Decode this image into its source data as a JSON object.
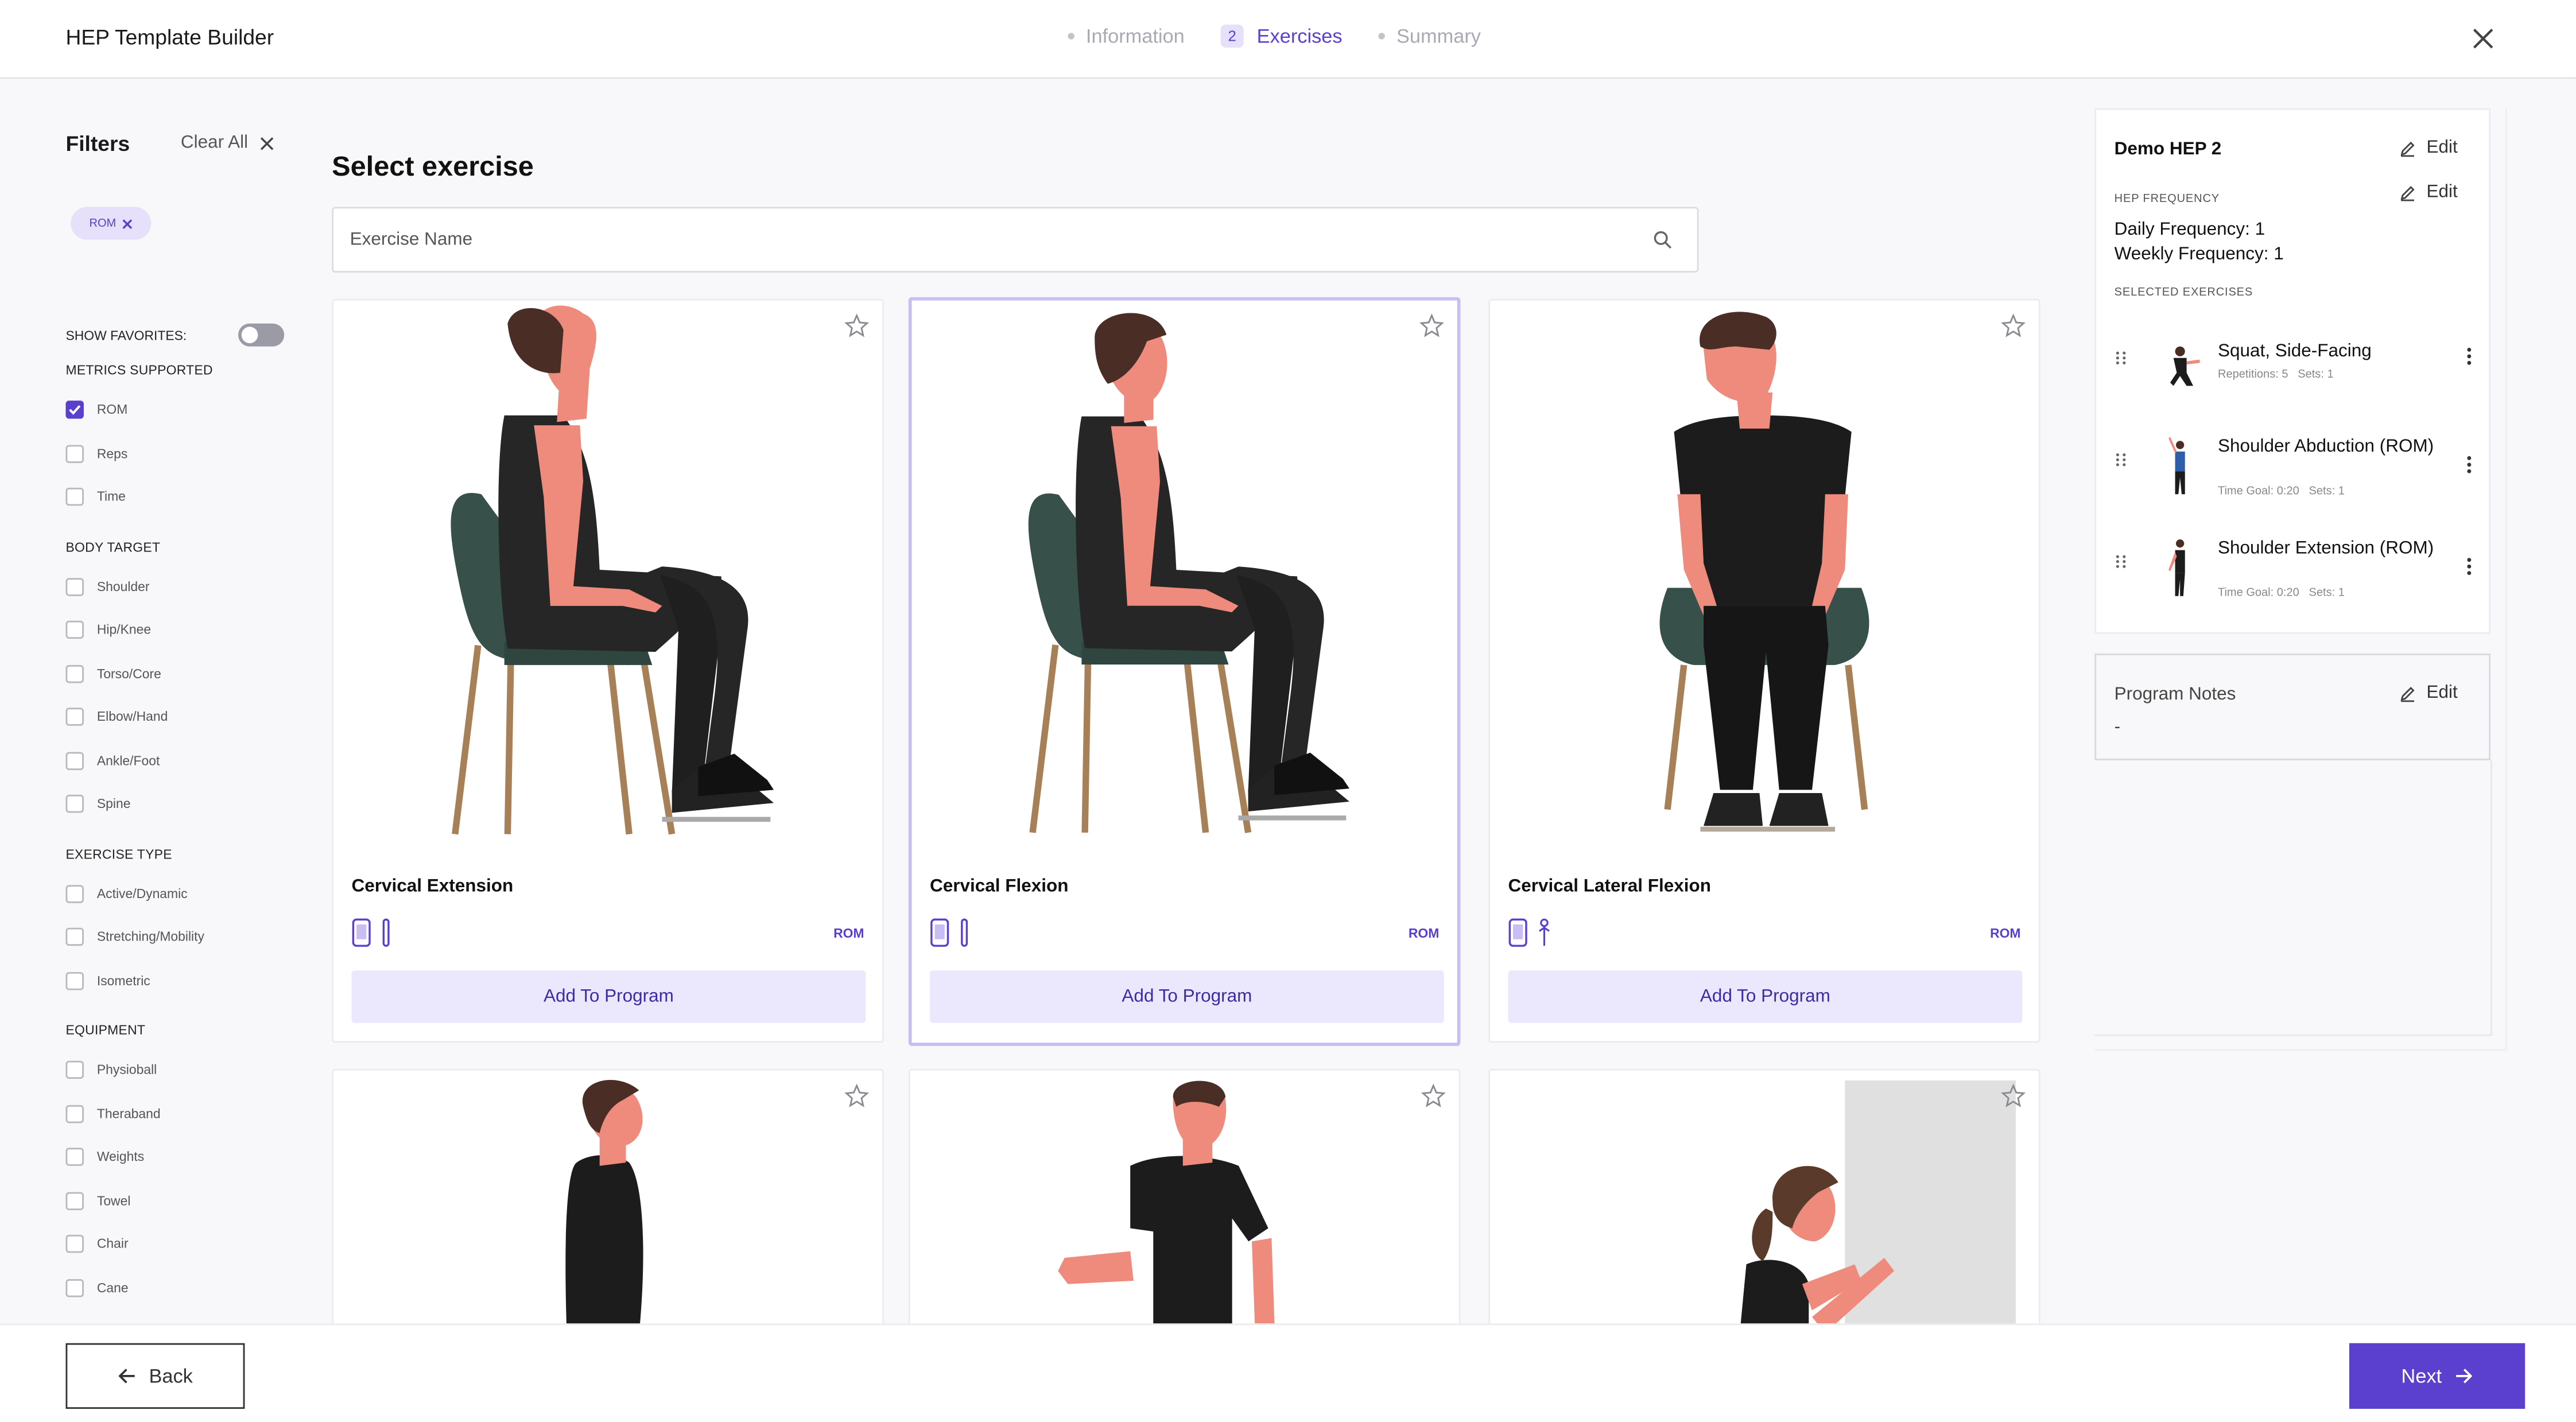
{
  "header": {
    "app_title": "HEP Template Builder",
    "steps": [
      {
        "label": "Information",
        "number": ""
      },
      {
        "label": "Exercises",
        "number": "2"
      },
      {
        "label": "Summary",
        "number": ""
      }
    ],
    "close_icon": "close-icon"
  },
  "filters": {
    "title": "Filters",
    "clear_all": "Clear All",
    "active_chips": [
      "ROM"
    ],
    "show_favorites_label": "SHOW FAVORITES:",
    "show_favorites_on": false,
    "sections": [
      {
        "title": "METRICS SUPPORTED",
        "options": [
          {
            "label": "ROM",
            "checked": true
          },
          {
            "label": "Reps",
            "checked": false
          },
          {
            "label": "Time",
            "checked": false
          }
        ]
      },
      {
        "title": "BODY TARGET",
        "options": [
          {
            "label": "Shoulder",
            "checked": false
          },
          {
            "label": "Hip/Knee",
            "checked": false
          },
          {
            "label": "Torso/Core",
            "checked": false
          },
          {
            "label": "Elbow/Hand",
            "checked": false
          },
          {
            "label": "Ankle/Foot",
            "checked": false
          },
          {
            "label": "Spine",
            "checked": false
          }
        ]
      },
      {
        "title": "EXERCISE TYPE",
        "options": [
          {
            "label": "Active/Dynamic",
            "checked": false
          },
          {
            "label": "Stretching/Mobility",
            "checked": false
          },
          {
            "label": "Isometric",
            "checked": false
          }
        ]
      },
      {
        "title": "EQUIPMENT",
        "options": [
          {
            "label": "Physioball",
            "checked": false
          },
          {
            "label": "Theraband",
            "checked": false
          },
          {
            "label": "Weights",
            "checked": false
          },
          {
            "label": "Towel",
            "checked": false
          },
          {
            "label": "Chair",
            "checked": false
          },
          {
            "label": "Cane",
            "checked": false
          }
        ]
      }
    ]
  },
  "main": {
    "title": "Select exercise",
    "search_placeholder": "Exercise Name",
    "exercises": [
      {
        "name": "Cervical Extension",
        "tag": "ROM",
        "button": "Add To Program",
        "selected": false
      },
      {
        "name": "Cervical Flexion",
        "tag": "ROM",
        "button": "Add To Program",
        "selected": true
      },
      {
        "name": "Cervical Lateral Flexion",
        "tag": "ROM",
        "button": "Add To Program",
        "selected": false
      }
    ]
  },
  "summary": {
    "program_name": "Demo HEP 2",
    "edit_label": "Edit",
    "frequency_heading": "HEP FREQUENCY",
    "daily_frequency": "Daily Frequency: 1",
    "weekly_frequency": "Weekly Frequency: 1",
    "selected_heading": "SELECTED EXERCISES",
    "selected_exercises": [
      {
        "name": "Squat, Side-Facing",
        "meta1": "Repetitions: 5",
        "meta2": "Sets: 1"
      },
      {
        "name": "Shoulder Abduction (ROM)",
        "meta1": "Time Goal: 0:20",
        "meta2": "Sets: 1"
      },
      {
        "name": "Shoulder Extension (ROM)",
        "meta1": "Time Goal: 0:20",
        "meta2": "Sets: 1"
      }
    ],
    "notes_title": "Program Notes",
    "notes_value": "-"
  },
  "footer": {
    "back": "Back",
    "next": "Next"
  },
  "colors": {
    "accent": "#5b3fcf",
    "accent_light": "#ebe7fd",
    "chip_bg": "#e6e0fb"
  }
}
